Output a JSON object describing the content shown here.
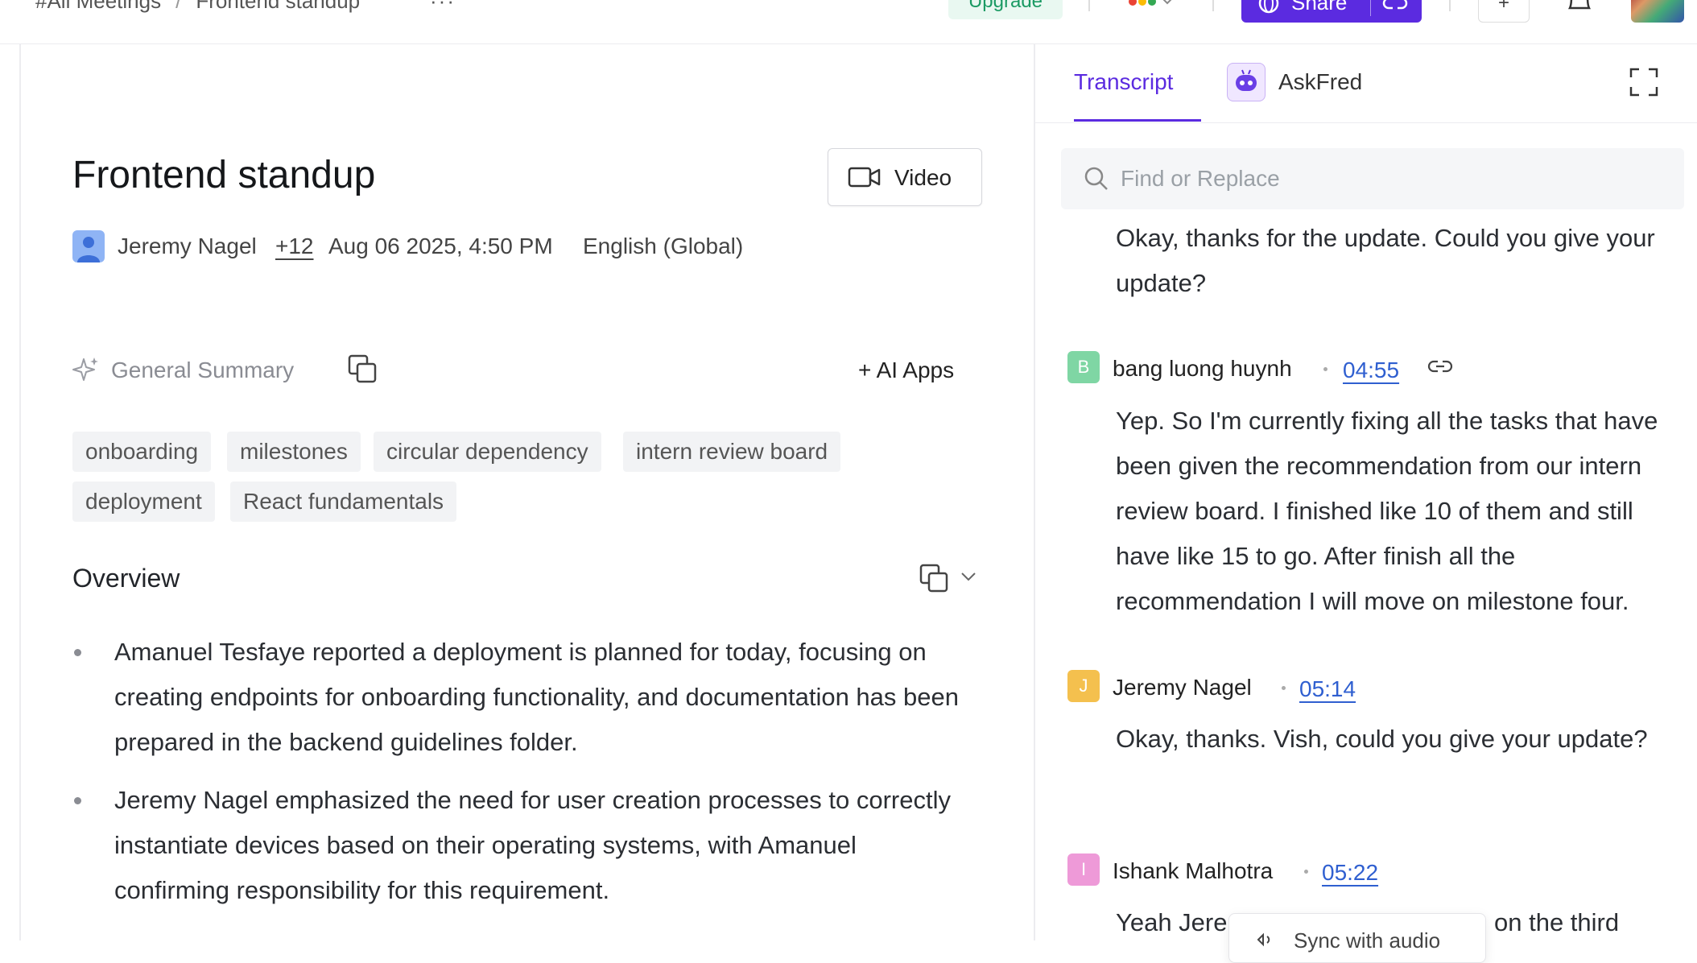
{
  "topbar": {
    "breadcrumb_root": "#All Meetings",
    "breadcrumb_sep": "/",
    "breadcrumb_current": "Frontend standup",
    "more_label": "···",
    "upgrade_label": "Upgrade",
    "share_label": "Share",
    "small_button_label": "+"
  },
  "meeting": {
    "title": "Frontend standup",
    "video_label": "Video",
    "organizer": "Jeremy Nagel",
    "participants_more": "+12",
    "datetime": "Aug 06 2025, 4:50 PM",
    "language": "English (Global)"
  },
  "summary": {
    "label": "General Summary",
    "ai_apps_label": "+ AI Apps",
    "tags": [
      "onboarding",
      "milestones",
      "circular dependency",
      "intern review board",
      "deployment",
      "React fundamentals"
    ],
    "overview_heading": "Overview",
    "bullets": [
      "Amanuel Tesfaye reported a deployment is planned for today, focusing on creating endpoints for onboarding functionality, and documentation has been prepared in the backend guidelines folder.",
      "Jeremy Nagel emphasized the need for user creation processes to correctly instantiate devices based on their operating systems, with Amanuel confirming responsibility for this requirement."
    ]
  },
  "right_panel": {
    "tab_transcript": "Transcript",
    "tab_askfred": "AskFred",
    "search_placeholder": "Find or Replace",
    "first_text": "Okay, thanks for the update. Could you give your update?",
    "entries": [
      {
        "initial": "B",
        "name": "bang luong huynh",
        "time": "04:55",
        "text": "Yep. So I'm currently fixing all the tasks that have been given the recommendation from our intern review board. I finished like 10 of them and still have like 15 to go. After finish all the recommendation I will move on milestone four."
      },
      {
        "initial": "J",
        "name": "Jeremy Nagel",
        "time": "05:14",
        "text": "Okay, thanks. Vish, could you give your update?"
      },
      {
        "initial": "I",
        "name": "Ishank Malhotra",
        "time": "05:22",
        "text_start": "Yeah Jere",
        "text_end": "on the third"
      }
    ],
    "popover_text": "Sync with audio"
  },
  "colors": {
    "accent": "#5b2be0",
    "link": "#2f5fd0",
    "avatar_b": "#7fd6a4",
    "avatar_j": "#f4c04e",
    "avatar_i": "#ee9ad8"
  }
}
